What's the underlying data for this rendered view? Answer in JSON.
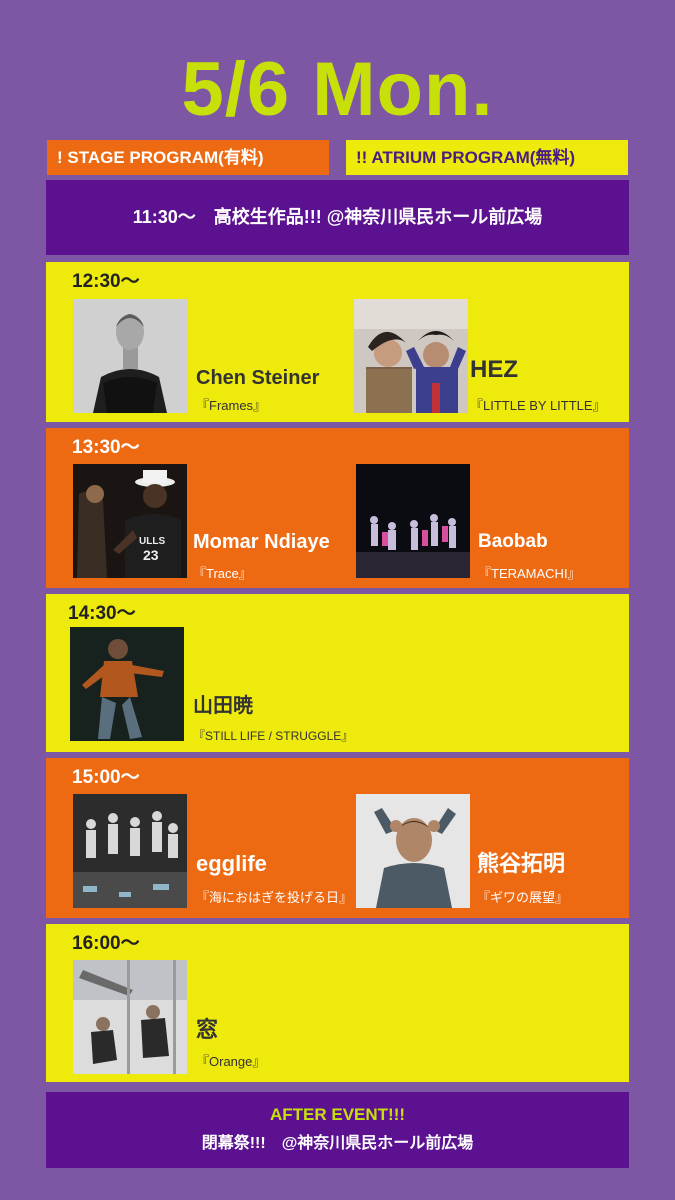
{
  "title": "5/6 Mon.",
  "legend": {
    "stage": "! STAGE PROGRAM(有料)",
    "atrium": "!! ATRIUM PROGRAM(無料)",
    "colors": {
      "stage": "#EE6A12",
      "atrium": "#EEEA0C",
      "accent_bar": "#5B1190",
      "background": "#7E57A4",
      "title": "#C8E00A"
    }
  },
  "opening": {
    "text": "11:30〜　高校生作品!!! @神奈川県民ホール前広場"
  },
  "slots": [
    {
      "time": "12:30〜",
      "type": "atrium",
      "performers": [
        {
          "name": "Chen Steiner",
          "work": "『Frames』",
          "photo": "portrait-bw"
        },
        {
          "name": "HEZ",
          "work": "『LITTLE BY LITTLE』",
          "photo": "duo-performers"
        }
      ]
    },
    {
      "time": "13:30〜",
      "type": "stage",
      "performers": [
        {
          "name": "Momar Ndiaye",
          "work": "『Trace』",
          "photo": "dancer-hat"
        },
        {
          "name": "Baobab",
          "work": "『TERAMACHI』",
          "photo": "group-stage"
        }
      ]
    },
    {
      "time": "14:30〜",
      "type": "atrium",
      "performers": [
        {
          "name": "山田暁",
          "work": "『STILL LIFE / STRUGGLE』",
          "photo": "solo-dancer"
        }
      ]
    },
    {
      "time": "15:00〜",
      "type": "stage",
      "performers": [
        {
          "name": "egglife",
          "work": "『海におはぎを投げる日』",
          "photo": "group-bw"
        },
        {
          "name": "熊谷拓明",
          "work": "『ギワの展望』",
          "photo": "man-portrait"
        }
      ]
    },
    {
      "time": "16:00〜",
      "type": "atrium",
      "performers": [
        {
          "name": "窓",
          "work": "『Orange』",
          "photo": "aerial-duo"
        }
      ]
    }
  ],
  "after_event": {
    "title": "AFTER EVENT!!!",
    "venue": "閉幕祭!!!　@神奈川県民ホール前広場"
  }
}
